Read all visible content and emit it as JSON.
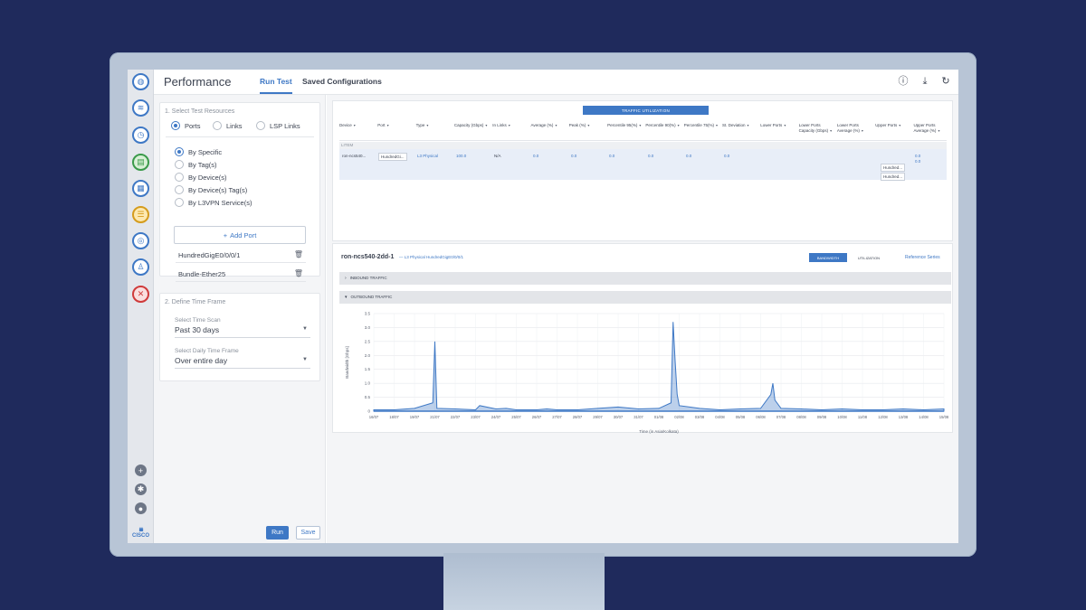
{
  "header": {
    "title": "Performance",
    "tabs": [
      {
        "label": "Run Test",
        "active": true
      },
      {
        "label": "Saved Configurations",
        "active": false
      }
    ],
    "icons": [
      "help-icon",
      "download-icon",
      "refresh-icon"
    ]
  },
  "rail": {
    "icons": [
      "globe-icon",
      "network-icon",
      "clock-icon",
      "document-icon",
      "dashboard-icon",
      "layers-icon",
      "target-icon",
      "person-icon",
      "alert-icon"
    ],
    "bottom_icons": [
      "add-icon",
      "settings-icon",
      "user-icon"
    ],
    "brand": "CISCO"
  },
  "config": {
    "section1_title": "1. Select Test Resources",
    "resource_types": [
      {
        "label": "Ports",
        "selected": true
      },
      {
        "label": "Links",
        "selected": false
      },
      {
        "label": "LSP Links",
        "selected": false
      }
    ],
    "filters": [
      {
        "label": "By Specific",
        "selected": true
      },
      {
        "label": "By Tag(s)",
        "selected": false
      },
      {
        "label": "By Device(s)",
        "selected": false
      },
      {
        "label": "By Device(s) Tag(s)",
        "selected": false
      },
      {
        "label": "By L3VPN Service(s)",
        "selected": false
      }
    ],
    "add_port_label": "Add Port",
    "ports": [
      "HundredGigE0/0/0/1",
      "Bundle-Ether25"
    ],
    "section2_title": "2. Define Time Frame",
    "time_scan_label": "Select Time Scan",
    "time_scan_value": "Past 30 days",
    "daily_label": "Select Daily Time Frame",
    "daily_value": "Over entire day",
    "run_label": "Run",
    "save_label": "Save"
  },
  "table": {
    "button_label": "TRAFFIC UTILIZATION",
    "columns": [
      "Device",
      "Port",
      "Type",
      "Capacity (Gbps)",
      "In Links",
      "Average (%)",
      "Peak (%)",
      "Percentile 95(%)",
      "Percentile 90(%)",
      "Percentile 75(%)",
      "St. Deviation",
      "Lower Ports",
      "Lower Ports Capacity (Gbps)",
      "Lower Ports Average (%)",
      "Upper Ports",
      "Upper Ports Average (%)"
    ],
    "group_label": "LITEM",
    "row": {
      "device": "ron-ncs540...",
      "port": "HundredGi...",
      "type": "L3 Physical",
      "capacity": "100.0",
      "in_links": "N/A",
      "average": "0.0",
      "peak": "0.0",
      "p95": "0.0",
      "p90": "0.0",
      "p75": "0.0",
      "stdev": "0.0",
      "upper_ports": [
        "Hundred...",
        "Hundred..."
      ],
      "upper_avg": [
        "0.0",
        "0.0"
      ]
    }
  },
  "detail": {
    "device": "ron-ncs540-2dd-1",
    "subtitle": "— L3 Physical HundredGigE0/0/0/1",
    "toggle_on": "BANDWIDTH",
    "toggle_off": "UTILIZATION",
    "reference_link": "Reference Series",
    "inbound_label": "INBOUND TRAFFIC",
    "outbound_label": "OUTBOUND TRAFFIC"
  },
  "chart_data": {
    "type": "area",
    "ylabel": "Bandwidth [Gbps]",
    "xlabel": "Time (in Asia/Kolkata)",
    "ylim": [
      0,
      3.5
    ],
    "yticks": [
      "0",
      "0.5",
      "1.0",
      "1.5",
      "2.0",
      "2.5",
      "3.0",
      "3.5"
    ],
    "xticks": [
      "16/07",
      "18/07",
      "19/07",
      "21/07",
      "22/07",
      "23/07",
      "24/07",
      "25/07",
      "26/07",
      "27/07",
      "28/07",
      "29/07",
      "30/07",
      "31/07",
      "01/08",
      "02/08",
      "03/08",
      "04/08",
      "05/08",
      "06/08",
      "07/08",
      "08/08",
      "09/08",
      "10/08",
      "11/08",
      "12/08",
      "13/08",
      "14/08",
      "15/08"
    ],
    "grid": true,
    "color": "#3e78c5",
    "series": [
      {
        "x": [
          0,
          1,
          2,
          2.9,
          3.0,
          3.1,
          4,
          5,
          5.2,
          6,
          6.5,
          7,
          8,
          8.5,
          9,
          10,
          11,
          12,
          13,
          14,
          14.6,
          14.7,
          14.8,
          14.9,
          15,
          16,
          17,
          18,
          19,
          19.5,
          19.6,
          19.7,
          20,
          21,
          22,
          23,
          24,
          25,
          26,
          27,
          28
        ],
        "y": [
          0.05,
          0.05,
          0.1,
          0.3,
          2.5,
          0.1,
          0.08,
          0.05,
          0.2,
          0.08,
          0.1,
          0.05,
          0.05,
          0.08,
          0.05,
          0.05,
          0.1,
          0.15,
          0.08,
          0.1,
          0.3,
          3.2,
          1.8,
          0.6,
          0.2,
          0.1,
          0.05,
          0.08,
          0.1,
          0.6,
          1.0,
          0.4,
          0.1,
          0.08,
          0.05,
          0.08,
          0.05,
          0.05,
          0.08,
          0.05,
          0.08
        ]
      }
    ]
  }
}
